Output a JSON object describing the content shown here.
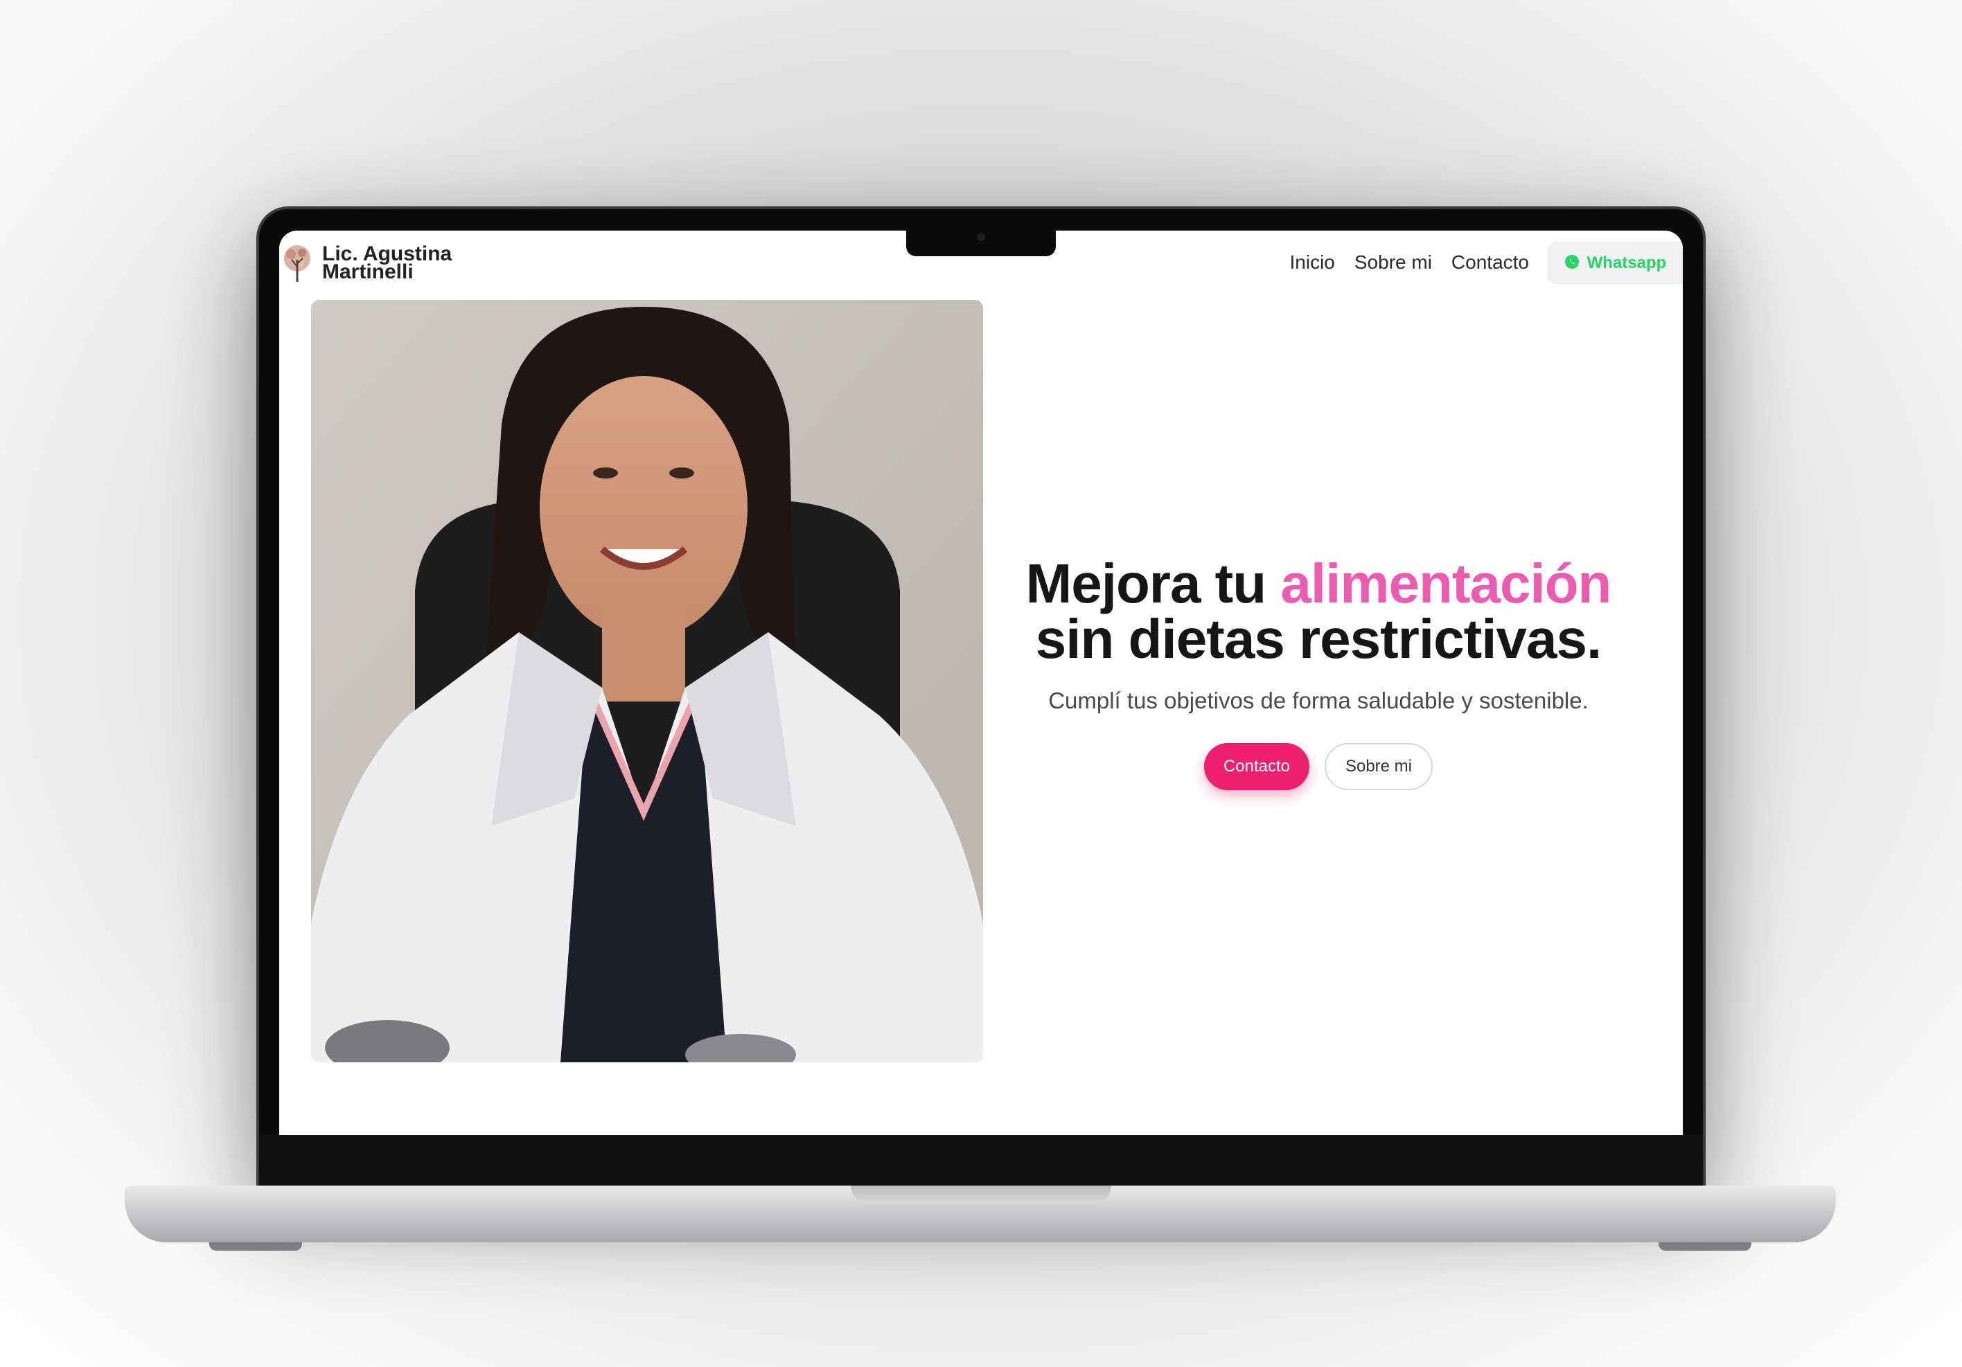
{
  "brand": {
    "line1": "Lic. Agustina",
    "line2": "Martinelli",
    "logo_icon": "tree-icon"
  },
  "nav": {
    "items": [
      {
        "label": "Inicio"
      },
      {
        "label": "Sobre mi"
      },
      {
        "label": "Contacto"
      }
    ],
    "whatsapp": {
      "label": "Whatsapp",
      "icon": "whatsapp-icon",
      "color": "#25d366"
    }
  },
  "hero": {
    "title_part1": "Mejora tu ",
    "title_accent": "alimentación",
    "title_part2": "sin dietas restrictivas.",
    "subtitle": "Cumplí tus objetivos de forma saludable y sostenible.",
    "primary_button": "Contacto",
    "secondary_button": "Sobre mi",
    "accent_color": "#ec5bb0",
    "primary_color": "#ee1f6e"
  }
}
